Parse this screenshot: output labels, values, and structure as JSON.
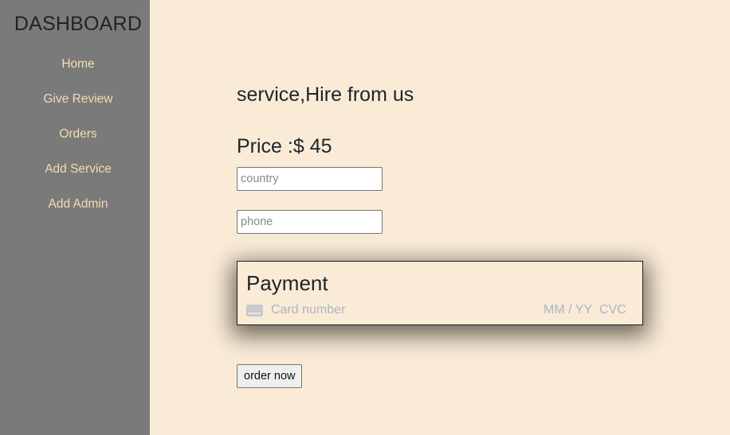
{
  "sidebar": {
    "title": "DASHBOARD",
    "items": [
      {
        "label": "Home"
      },
      {
        "label": "Give Review"
      },
      {
        "label": "Orders"
      },
      {
        "label": "Add Service"
      },
      {
        "label": "Add Admin"
      }
    ]
  },
  "main": {
    "service_title": "service,Hire from us",
    "price_label": "Price :$ 45",
    "country": {
      "placeholder": "country",
      "value": ""
    },
    "phone": {
      "placeholder": "phone",
      "value": ""
    },
    "payment": {
      "title": "Payment",
      "card_icon": "credit-card-icon",
      "card_number_placeholder": "Card number",
      "expiry_placeholder": "MM / YY",
      "cvc_placeholder": "CVC"
    },
    "order_button": "order now"
  },
  "colors": {
    "sidebar_bg": "#7a7a7a",
    "sidebar_link": "#f3ddb0",
    "page_bg": "#faebd7",
    "placeholder_text": "#aab5c1"
  }
}
